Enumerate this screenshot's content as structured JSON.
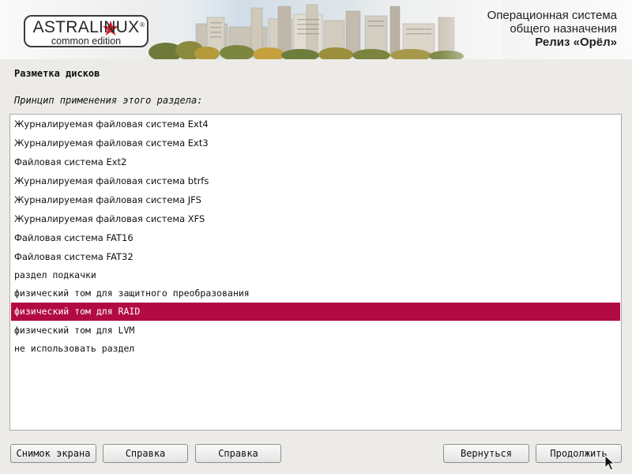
{
  "header": {
    "logo_main": "ASTRALINUX",
    "logo_sub": "common edition",
    "logo_reg": "®",
    "os_line1": "Операционная система",
    "os_line2": "общего назначения",
    "os_release": "Релиз «Орёл»"
  },
  "page": {
    "title": "Разметка дисков",
    "question": "Принцип применения этого раздела:"
  },
  "list": {
    "items": [
      "Журналируемая файловая система Ext4",
      "Журналируемая файловая система Ext3",
      "Файловая система Ext2",
      "Журналируемая файловая система btrfs",
      "Журналируемая файловая система JFS",
      "Журналируемая файловая система XFS",
      "Файловая система FAT16",
      "Файловая система FAT32",
      "раздел подкачки",
      "физический том для защитного преобразования",
      "физический том для RAID",
      "физический том для LVM",
      "не использовать раздел"
    ],
    "selected_index": 10
  },
  "buttons": {
    "screenshot": "Снимок экрана",
    "help1": "Справка",
    "help2": "Справка",
    "back": "Вернуться",
    "continue": "Продолжить"
  },
  "colors": {
    "selection": "#b20b43",
    "logo_star": "#d32031",
    "background": "#edebe7"
  },
  "icons": {
    "logo": "red-star-icon",
    "cursor": "mouse-pointer-icon"
  }
}
